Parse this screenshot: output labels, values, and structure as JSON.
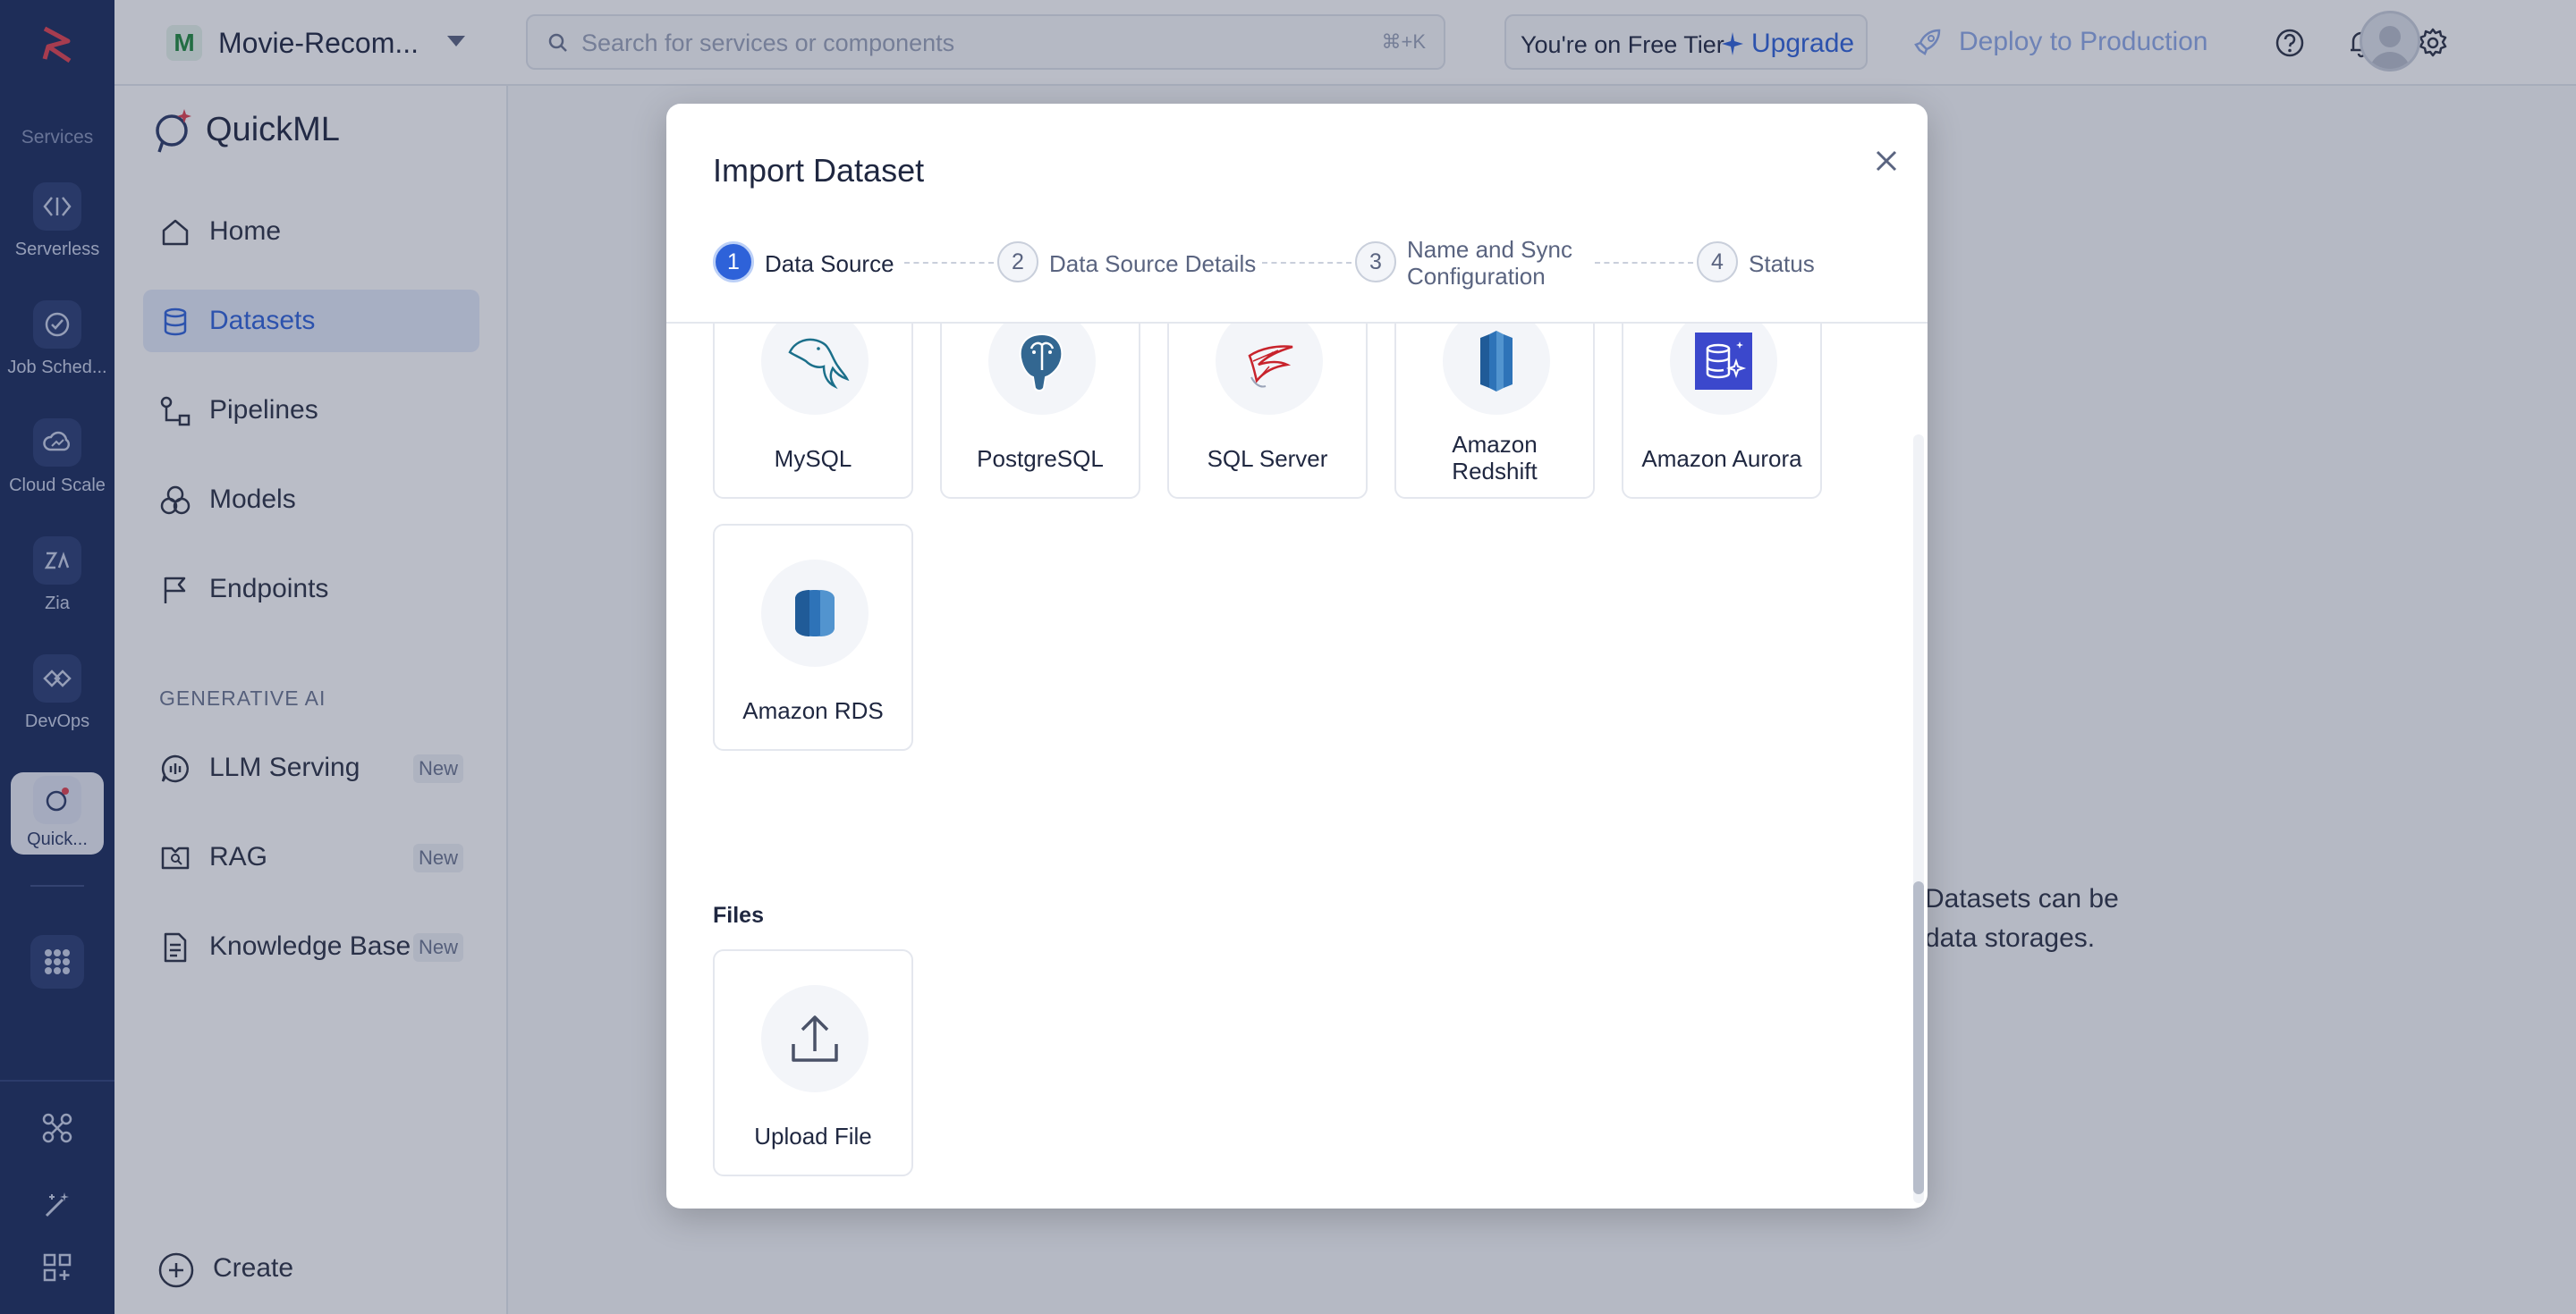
{
  "rail": {
    "section_label": "Services",
    "items": [
      {
        "label": "Serverless",
        "icon": "serverless-icon"
      },
      {
        "label": "Job Sched...",
        "icon": "job-scheduling-icon"
      },
      {
        "label": "Cloud Scale",
        "icon": "cloud-scale-icon"
      },
      {
        "label": "Zia",
        "icon": "zia-icon"
      },
      {
        "label": "DevOps",
        "icon": "devops-icon"
      },
      {
        "label": "Quick...",
        "icon": "quickml-icon",
        "active": true
      }
    ]
  },
  "topbar": {
    "project_initial": "M",
    "project_name": "Movie-Recom...",
    "search_placeholder": "Search for services or components",
    "search_shortcut": "⌘+K",
    "tier_text": "You're on Free Tier",
    "upgrade_label": "Upgrade",
    "deploy_label": "Deploy to Production"
  },
  "sidenav": {
    "title": "QuickML",
    "items": [
      {
        "label": "Home"
      },
      {
        "label": "Datasets",
        "active": true
      },
      {
        "label": "Pipelines"
      },
      {
        "label": "Models"
      },
      {
        "label": "Endpoints"
      }
    ],
    "gen_ai_label": "GENERATIVE AI",
    "gen_ai_items": [
      {
        "label": "LLM Serving",
        "badge": "New"
      },
      {
        "label": "RAG",
        "badge": "New"
      },
      {
        "label": "Knowledge Base",
        "badge": "New"
      }
    ],
    "create_label": "Create"
  },
  "content": {
    "behind_text_line1": "Datasets can be",
    "behind_text_line2": "data storages."
  },
  "modal": {
    "title": "Import Dataset",
    "steps": [
      {
        "num": "1",
        "label": "Data Source"
      },
      {
        "num": "2",
        "label": "Data Source Details"
      },
      {
        "num": "3",
        "label_line1": "Name and Sync",
        "label_line2": "Configuration"
      },
      {
        "num": "4",
        "label": "Status"
      }
    ],
    "sources": [
      {
        "name": "MySQL"
      },
      {
        "name": "PostgreSQL"
      },
      {
        "name": "SQL Server"
      },
      {
        "name_line1": "Amazon",
        "name_line2": "Redshift"
      },
      {
        "name": "Amazon Aurora"
      },
      {
        "name": "Amazon RDS"
      }
    ],
    "files_label": "Files",
    "file_sources": [
      {
        "name": "Upload File"
      }
    ]
  },
  "colors": {
    "rail_bg": "#1a2b5c",
    "accent": "#2e62d9",
    "active_nav_bg": "#e4ebfa"
  }
}
